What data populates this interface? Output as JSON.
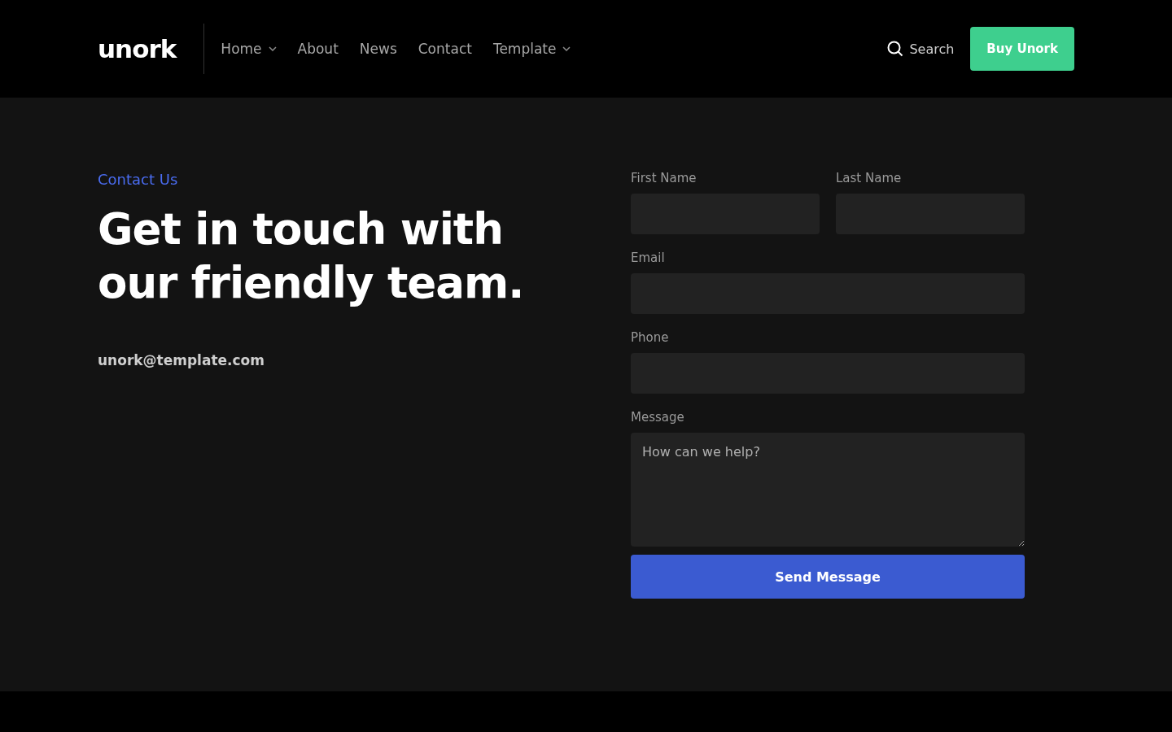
{
  "header": {
    "logo": "unork",
    "nav": [
      {
        "label": "Home",
        "kind": "dropdown"
      },
      {
        "label": "About",
        "kind": "link"
      },
      {
        "label": "News",
        "kind": "link"
      },
      {
        "label": "Contact",
        "kind": "link"
      },
      {
        "label": "Template",
        "kind": "dropdown"
      }
    ],
    "search": "Search",
    "cta": "Buy Unork"
  },
  "contact": {
    "eyebrow": "Contact Us",
    "heading_lines": [
      "Get in touch with",
      "our friendly team."
    ],
    "email": "unork@template.com"
  },
  "form": {
    "rows": [
      [
        {
          "label": "First Name",
          "kind": "input"
        },
        {
          "label": "Last Name",
          "kind": "input"
        }
      ],
      [
        {
          "label": "Email",
          "kind": "input"
        }
      ],
      [
        {
          "label": "Phone",
          "kind": "input"
        }
      ],
      [
        {
          "label": "Message",
          "kind": "textarea",
          "placeholder": "How can we help?"
        }
      ]
    ],
    "submit": "Send Message"
  }
}
